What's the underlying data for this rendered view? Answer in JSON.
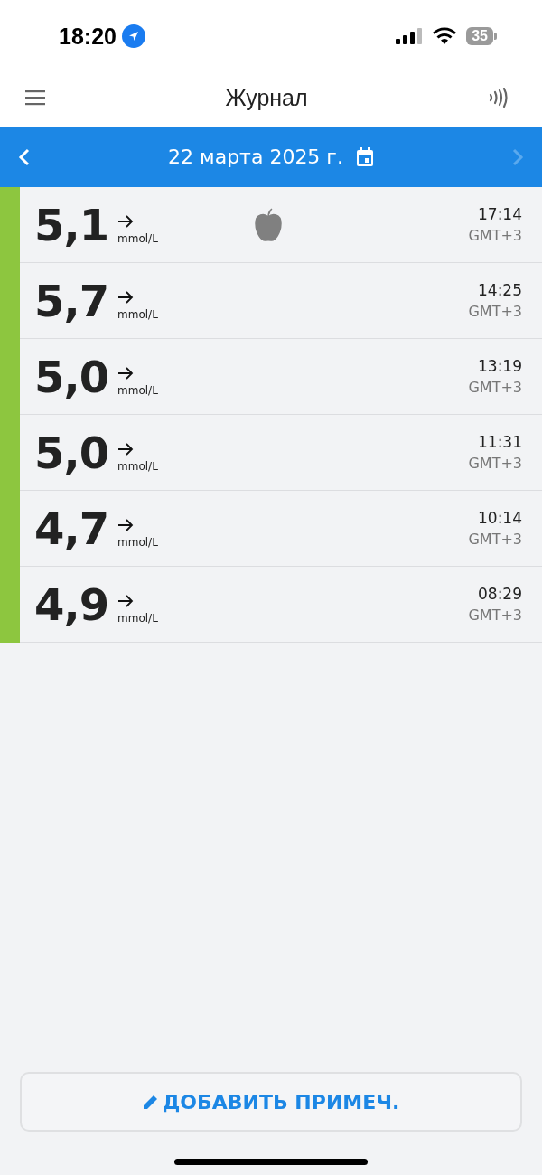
{
  "status_bar": {
    "time": "18:20",
    "battery": "35"
  },
  "header": {
    "title": "Журнал"
  },
  "date_bar": {
    "date": "22 марта 2025 г.",
    "next_disabled": true
  },
  "readings": [
    {
      "value": "5,1",
      "unit": "mmol/L",
      "time": "17:14",
      "zone": "GMT+3",
      "food": true
    },
    {
      "value": "5,7",
      "unit": "mmol/L",
      "time": "14:25",
      "zone": "GMT+3",
      "food": false
    },
    {
      "value": "5,0",
      "unit": "mmol/L",
      "time": "13:19",
      "zone": "GMT+3",
      "food": false
    },
    {
      "value": "5,0",
      "unit": "mmol/L",
      "time": "11:31",
      "zone": "GMT+3",
      "food": false
    },
    {
      "value": "4,7",
      "unit": "mmol/L",
      "time": "10:14",
      "zone": "GMT+3",
      "food": false
    },
    {
      "value": "4,9",
      "unit": "mmol/L",
      "time": "08:29",
      "zone": "GMT+3",
      "food": false
    }
  ],
  "add_note_button": "ДОБАВИТЬ ПРИМЕЧ."
}
